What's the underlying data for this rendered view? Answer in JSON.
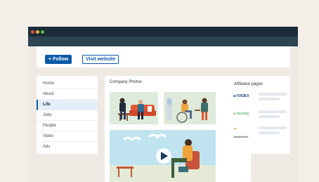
{
  "window": {
    "controls": [
      "close",
      "minimize",
      "maximize"
    ]
  },
  "profile": {
    "follow_label": "+ Follow",
    "visit_label": "Visit website"
  },
  "sidebar": {
    "items": [
      {
        "label": "Home",
        "active": false
      },
      {
        "label": "About",
        "active": false
      },
      {
        "label": "Life",
        "active": true
      },
      {
        "label": "Jobs",
        "active": false
      },
      {
        "label": "People",
        "active": false
      },
      {
        "label": "Video",
        "active": false
      },
      {
        "label": "Ads",
        "active": false
      }
    ]
  },
  "photos": {
    "title": "Company Photos",
    "play_icon": "play-icon"
  },
  "affiliated": {
    "title": "Affiliated pages",
    "pages": [
      {
        "name": "FIXDEX",
        "color": "#1c3d7a",
        "icon": "fixdex-logo-icon"
      },
      {
        "name": "freshing",
        "color": "#3aa655",
        "icon": "freshing-logo-icon"
      },
      {
        "name": "GardenPlace",
        "color": "#e8902d",
        "icon": "gardenplace-logo-icon"
      }
    ]
  },
  "colors": {
    "accent": "#0b5aa8",
    "titlebar": "#1b2b38",
    "banner": "#2d4452",
    "page_bg": "#f3efe8"
  }
}
